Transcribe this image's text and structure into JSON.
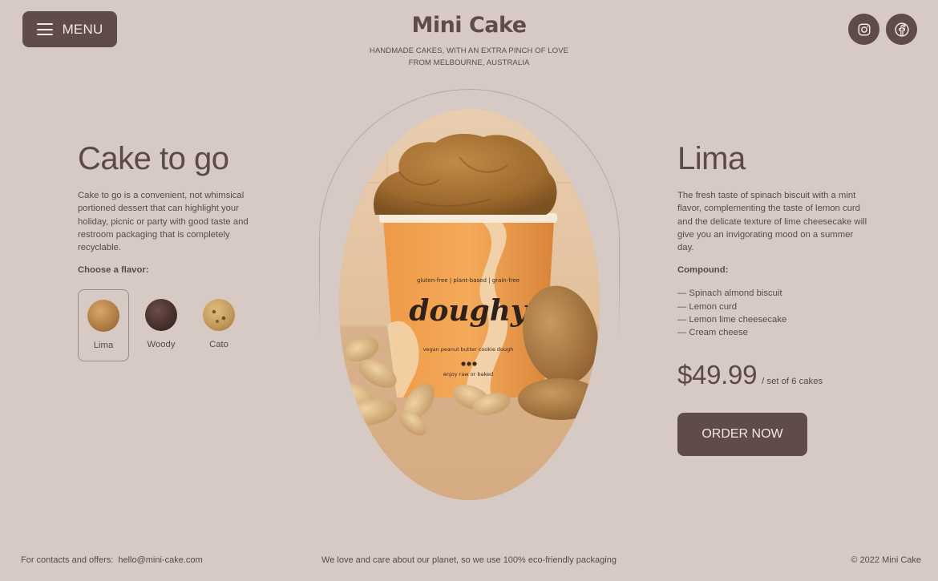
{
  "header": {
    "menu_label": "MENU",
    "brand": "Mini Cake",
    "tagline_line1": "HANDMADE CAKES, WITH AN EXTRA PINCH OF LOVE",
    "tagline_line2": "FROM MELBOURNE, AUSTRALIA",
    "social": [
      "instagram-icon",
      "facebook-icon"
    ]
  },
  "left": {
    "title": "Cake to go",
    "description": "Cake to go is a convenient, not whimsical portioned dessert that can highlight your holiday, picnic or party with good taste and restroom packaging that is completely recyclable.",
    "choose_label": "Choose a flavor:",
    "flavors": [
      {
        "name": "Lima",
        "selected": true,
        "color": "#b9864a"
      },
      {
        "name": "Woody",
        "selected": false,
        "color": "#4b3430"
      },
      {
        "name": "Cato",
        "selected": false,
        "color": "#c49a5c"
      }
    ]
  },
  "product_image": {
    "cup_top_text": "gluten-free | plant-based | grain-free",
    "cup_brand": "doughy",
    "cup_sub_text": "vegan peanut butter cookie dough",
    "cup_bottom_text": "enjoy raw or baked"
  },
  "right": {
    "title": "Lima",
    "description": "The fresh taste of spinach biscuit with a mint flavor, complementing the taste of lemon curd and the delicate texture of lime cheesecake will give you an invigorating mood on a summer day.",
    "compound_label": "Compound:",
    "compound": [
      "— Spinach almond biscuit",
      "— Lemon curd",
      "— Lemon lime cheesecake",
      "— Cream cheese"
    ],
    "price": "$49.99",
    "price_unit": "/ set of 6 cakes",
    "order_label": "ORDER NOW"
  },
  "footer": {
    "contacts_label": "For contacts and offers:",
    "email": "hello@mini-cake.com",
    "eco_note": "We love and care about our planet, so we use 100% eco-friendly packaging",
    "copyright": "© 2022 Mini Cake"
  },
  "colors": {
    "background": "#d7cac4",
    "accent": "#5e4b4a",
    "text": "#5b4a48"
  }
}
